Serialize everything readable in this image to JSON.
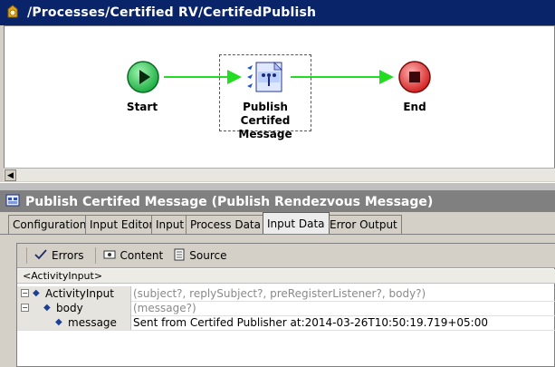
{
  "window": {
    "title": "/Processes/Certified RV/CertifedPublish",
    "icon": "process-icon"
  },
  "canvas": {
    "start_label": "Start",
    "activity_label_line1": "Publish Certifed",
    "activity_label_line2": "Message",
    "end_label": "End",
    "colors": {
      "start": "#1fbf4a",
      "end": "#e22a2a",
      "transition": "#22dd22"
    }
  },
  "panel": {
    "title": "Publish Certifed Message (Publish Rendezvous Message)",
    "tabs": [
      "Configuration",
      "Input Editor",
      "Input",
      "Process Data",
      "Input Data",
      "Error Output"
    ],
    "active_tab": "Input Data"
  },
  "toolbar": {
    "errors_label": "Errors",
    "content_label": "Content",
    "source_label": "Source"
  },
  "tree": {
    "root_breadcrumb": "<ActivityInput>",
    "rows": [
      {
        "name": "ActivityInput",
        "value": "(subject?, replySubject?, preRegisterListener?, body?)"
      },
      {
        "name": "body",
        "value": "(message?)"
      },
      {
        "name": "message",
        "value": "Sent from Certifed Publisher at:2014-03-26T10:50:19.719+05:00"
      }
    ]
  }
}
